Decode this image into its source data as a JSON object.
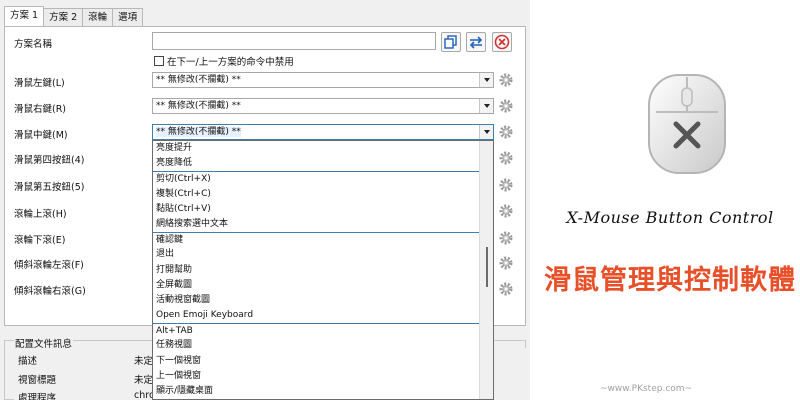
{
  "tabs": [
    "方案 1",
    "方案 2",
    "滾輪",
    "選項"
  ],
  "profile_name_label": "方案名稱",
  "disable_checkbox_label": "在下一/上一方案的命令中禁用",
  "rows": [
    {
      "label": "滑鼠左鍵(L)",
      "value": "** 無修改(不攔截) **"
    },
    {
      "label": "滑鼠右鍵(R)",
      "value": "** 無修改(不攔截) **"
    },
    {
      "label": "滑鼠中鍵(M)",
      "value": "** 無修改(不攔截) **"
    },
    {
      "label": "滑鼠第四按鈕(4)",
      "value": ""
    },
    {
      "label": "滑鼠第五按鈕(5)",
      "value": ""
    },
    {
      "label": "滾輪上滾(H)",
      "value": ""
    },
    {
      "label": "滾輪下滾(E)",
      "value": ""
    },
    {
      "label": "傾斜滾輪左滾(F)",
      "value": ""
    },
    {
      "label": "傾斜滾輪右滾(G)",
      "value": ""
    }
  ],
  "dropdown_items": [
    "亮度提升",
    "亮度降低",
    "剪切(Ctrl+X)",
    "複製(Ctrl+C)",
    "黏貼(Ctrl+V)",
    "網絡搜索選中文本",
    "確認鍵",
    "退出",
    "打開幫助",
    "全屏截圖",
    "活動視窗截圖",
    "Open Emoji Keyboard",
    "Alt+TAB",
    "任務視圖",
    "下一個視窗",
    "上一個視窗",
    "顯示/隱藏桌面"
  ],
  "config": {
    "title": "配置文件訊息",
    "rows": [
      {
        "label": "描述",
        "value": "未定"
      },
      {
        "label": "視窗標題",
        "value": "未定"
      },
      {
        "label": "處理程序",
        "value": "chro"
      }
    ]
  },
  "promo": {
    "title_en": "X-Mouse Button Control",
    "title_zh": "滑鼠管理與控制軟體",
    "watermark": "~www.PKstep.com~"
  },
  "colors": {
    "accent_blue": "#1f5fbf",
    "close_red": "#d32f2f",
    "title_zh": "#e8502a"
  }
}
